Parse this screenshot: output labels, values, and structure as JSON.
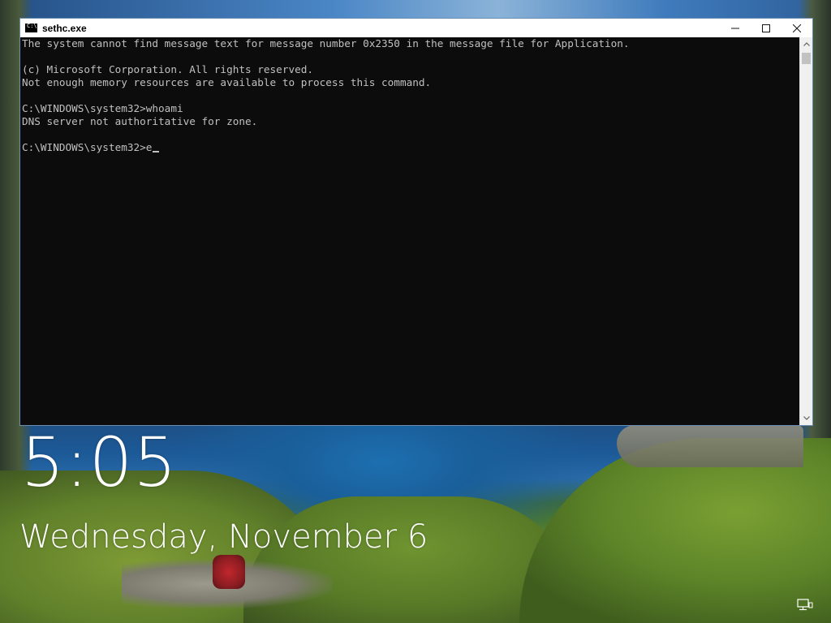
{
  "window": {
    "title": "sethc.exe",
    "icon": "console-icon"
  },
  "console": {
    "lines": [
      "The system cannot find message text for message number 0x2350 in the message file for Application.",
      "",
      "(c) Microsoft Corporation. All rights reserved.",
      "Not enough memory resources are available to process this command.",
      "",
      "C:\\WINDOWS\\system32>whoami",
      "DNS server not authoritative for zone.",
      ""
    ],
    "prompt": "C:\\WINDOWS\\system32>",
    "current_input": "e"
  },
  "lockscreen": {
    "time": "5:05",
    "date": "Wednesday, November 6"
  },
  "icons": {
    "minimize": "minimize-icon",
    "maximize": "maximize-icon",
    "close": "close-icon",
    "scroll_up": "chevron-up-icon",
    "scroll_down": "chevron-down-icon",
    "network": "network-icon"
  },
  "colors": {
    "console_background": "#0c0c0c",
    "console_text": "#c0c0c0",
    "titlebar": "#ffffff"
  }
}
